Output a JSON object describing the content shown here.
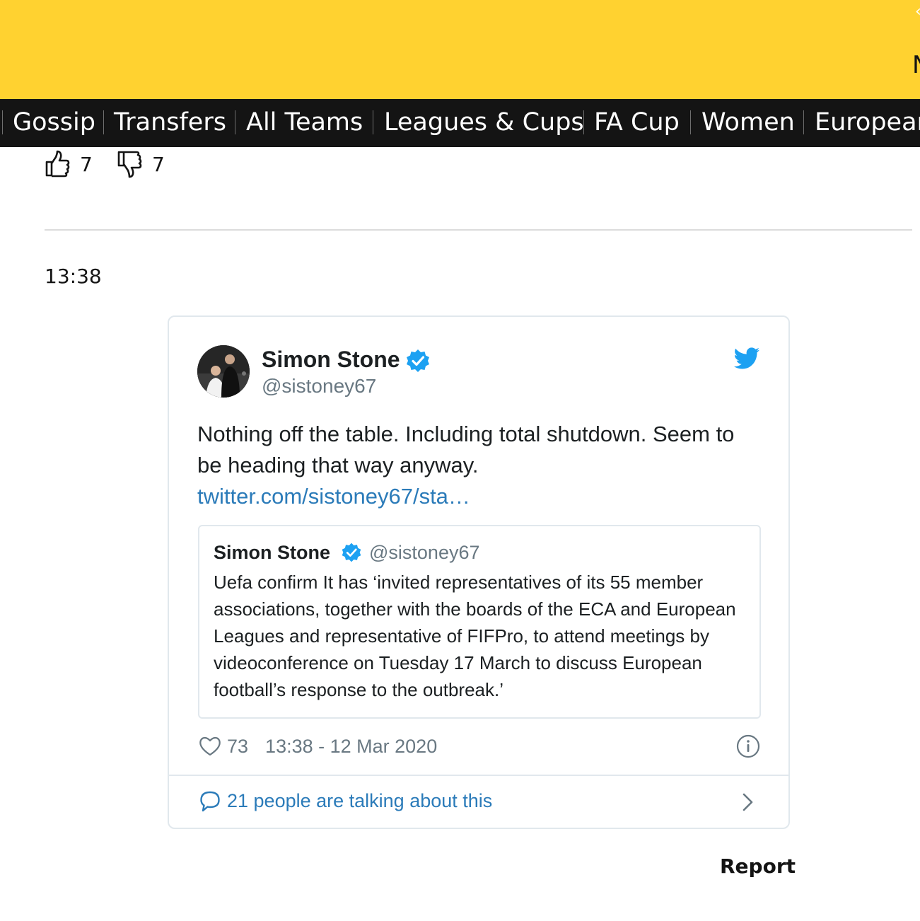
{
  "header": {
    "edge_text": "N",
    "edge_glyph": "‹"
  },
  "nav": {
    "items": [
      {
        "label": "Gossip"
      },
      {
        "label": "Transfers"
      },
      {
        "label": "All Teams"
      },
      {
        "label": "Leagues & Cups"
      },
      {
        "label": "FA Cup"
      },
      {
        "label": "Women"
      },
      {
        "label": "European"
      }
    ]
  },
  "votes": {
    "up_count": "7",
    "down_count": "7",
    "icons": [
      "thumbs-up-icon",
      "thumbs-down-icon"
    ]
  },
  "post": {
    "time": "13:38"
  },
  "tweet": {
    "author_name": "Simon Stone",
    "author_handle": "@sistoney67",
    "text": "Nothing off the table. Including total shutdown. Seem to be heading that way anyway.",
    "link_text": "twitter.com/sistoney67/sta…",
    "quote": {
      "author_name": "Simon Stone",
      "author_handle": "@sistoney67",
      "text": "Uefa confirm It has ‘invited representatives of its 55 member associations, together with the boards of the ECA and European Leagues and representative of FIFPro, to attend meetings by videoconference on Tuesday 17 March to discuss European football’s response to the outbreak.’"
    },
    "like_count": "73",
    "timestamp": "13:38 - 12 Mar 2020",
    "talking_text": "21 people are talking about this",
    "colors": {
      "verified": "#1da1f2",
      "link": "#2b7bb9",
      "muted": "#697882"
    }
  },
  "report_label": "Report",
  "colors": {
    "brand_yellow": "#FFD230",
    "nav_bg": "#141414"
  }
}
